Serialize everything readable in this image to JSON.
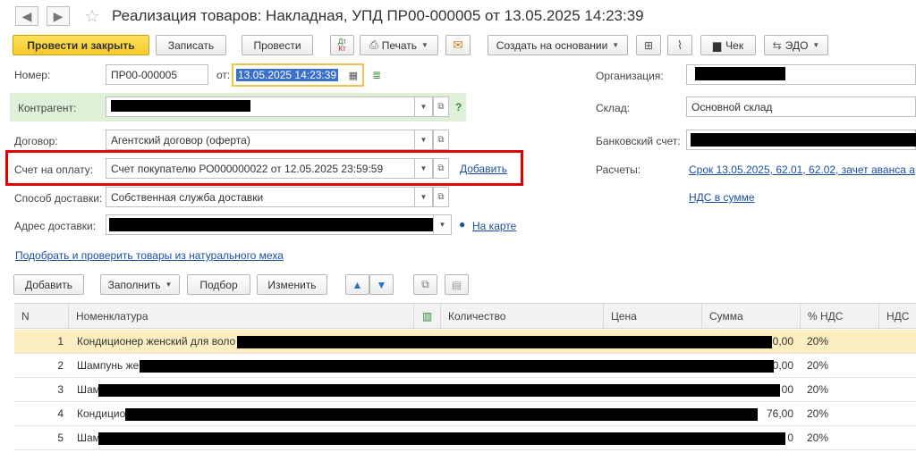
{
  "window": {
    "title": "Реализация товаров: Накладная, УПД ПР00-000005 от 13.05.2025 14:23:39",
    "back_icon": "arrow-left-icon",
    "forward_icon": "arrow-right-icon",
    "favorite_icon": "star-icon"
  },
  "toolbar": {
    "post_close": "Провести и закрыть",
    "save": "Записать",
    "post": "Провести",
    "dt_kt_top": "Дт",
    "dt_kt_bottom": "Кт",
    "print": "Печать",
    "create_based": "Создать на основании",
    "check": "Чек",
    "edo": "ЭДО"
  },
  "form": {
    "number_label": "Номер:",
    "number_value": "ПР00-000005",
    "date_from_label": "от:",
    "date_value": "13.05.2025 14:23:39",
    "counterparty_label": "Контрагент:",
    "contract_label": "Договор:",
    "contract_value": "Агентский договор (оферта)",
    "invoice_label": "Счет на оплату:",
    "invoice_value": "Счет покупателю РО000000022 от 12.05.2025 23:59:59",
    "invoice_add_link": "Добавить",
    "delivery_method_label": "Способ доставки:",
    "delivery_method_value": "Собственная служба доставки",
    "delivery_address_label": "Адрес доставки:",
    "map_link": "На карте",
    "organization_label": "Организация:",
    "warehouse_label": "Склад:",
    "warehouse_value": "Основной склад",
    "bank_account_label": "Банковский счет:",
    "settlements_label": "Расчеты:",
    "settlements_link": "Срок 13.05.2025, 62.01, 62.02, зачет аванса а",
    "vat_link": "НДС в сумме",
    "help_mark": "?",
    "pick_link": "Подобрать и проверить товары из натурального меха"
  },
  "table_toolbar": {
    "add": "Добавить",
    "fill": "Заполнить",
    "pick": "Подбор",
    "change": "Изменить"
  },
  "table": {
    "columns": [
      "N",
      "Номенклатура",
      "Количество",
      "Цена",
      "Сумма",
      "% НДС",
      "НДС"
    ],
    "rows": [
      {
        "n": "1",
        "name": "Кондиционер женский для воло",
        "sum": "0,00",
        "vat": "20%"
      },
      {
        "n": "2",
        "name": "Шампунь же",
        "sum": "0,00",
        "vat": "20%"
      },
      {
        "n": "3",
        "name": "Шам",
        "sum": "00",
        "vat": "20%"
      },
      {
        "n": "4",
        "name": "Кондицио",
        "sum": "76,00",
        "vat": "20%"
      },
      {
        "n": "5",
        "name": "Шам",
        "sum": "0",
        "vat": "20%"
      }
    ]
  },
  "colors": {
    "primary_button": "#f5c92b",
    "highlight_box": "#e00000",
    "selected_row": "#fbeec0",
    "counterparty_bg": "#dff0d8",
    "link": "#1a4fa0"
  }
}
